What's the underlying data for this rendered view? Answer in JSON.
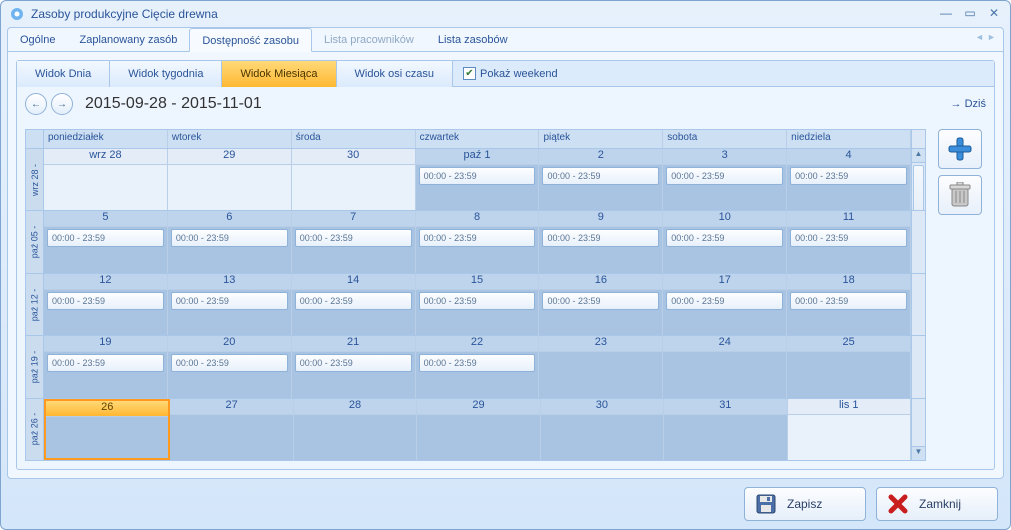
{
  "window": {
    "title": "Zasoby produkcyjne Cięcie drewna"
  },
  "mainTabs": {
    "items": [
      {
        "label": "Ogólne",
        "active": false,
        "disabled": false
      },
      {
        "label": "Zaplanowany zasób",
        "active": false,
        "disabled": false
      },
      {
        "label": "Dostępność zasobu",
        "active": true,
        "disabled": false
      },
      {
        "label": "Lista pracowników",
        "active": false,
        "disabled": true
      },
      {
        "label": "Lista zasobów",
        "active": false,
        "disabled": false
      }
    ]
  },
  "viewTabs": {
    "items": [
      {
        "label": "Widok Dnia",
        "active": false
      },
      {
        "label": "Widok tygodnia",
        "active": false
      },
      {
        "label": "Widok Miesiąca",
        "active": true
      },
      {
        "label": "Widok osi czasu",
        "active": false
      }
    ],
    "showWeekendLabel": "Pokaż weekend",
    "showWeekendChecked": true
  },
  "dateRange": "2015-09-28 - 2015-11-01",
  "todayLabel": "Dziś",
  "dayHeaders": [
    "poniedziałek",
    "wtorek",
    "środa",
    "czwartek",
    "piątek",
    "sobota",
    "niedziela"
  ],
  "entryText": "00:00 - 23:59",
  "rows": [
    {
      "label": "wrz 28 -",
      "cells": [
        {
          "day": "wrz 28",
          "outside": true,
          "entry": false
        },
        {
          "day": "29",
          "outside": true,
          "entry": false
        },
        {
          "day": "30",
          "outside": true,
          "entry": false
        },
        {
          "day": "paź 1",
          "outside": false,
          "entry": true
        },
        {
          "day": "2",
          "outside": false,
          "entry": true
        },
        {
          "day": "3",
          "outside": false,
          "entry": true
        },
        {
          "day": "4",
          "outside": false,
          "entry": true
        }
      ]
    },
    {
      "label": "paź 05 -",
      "cells": [
        {
          "day": "5",
          "outside": false,
          "entry": true
        },
        {
          "day": "6",
          "outside": false,
          "entry": true
        },
        {
          "day": "7",
          "outside": false,
          "entry": true
        },
        {
          "day": "8",
          "outside": false,
          "entry": true
        },
        {
          "day": "9",
          "outside": false,
          "entry": true
        },
        {
          "day": "10",
          "outside": false,
          "entry": true
        },
        {
          "day": "11",
          "outside": false,
          "entry": true
        }
      ]
    },
    {
      "label": "paź 12 -",
      "cells": [
        {
          "day": "12",
          "outside": false,
          "entry": true
        },
        {
          "day": "13",
          "outside": false,
          "entry": true
        },
        {
          "day": "14",
          "outside": false,
          "entry": true
        },
        {
          "day": "15",
          "outside": false,
          "entry": true
        },
        {
          "day": "16",
          "outside": false,
          "entry": true
        },
        {
          "day": "17",
          "outside": false,
          "entry": true
        },
        {
          "day": "18",
          "outside": false,
          "entry": true
        }
      ]
    },
    {
      "label": "paź 19 -",
      "cells": [
        {
          "day": "19",
          "outside": false,
          "entry": true
        },
        {
          "day": "20",
          "outside": false,
          "entry": true
        },
        {
          "day": "21",
          "outside": false,
          "entry": true
        },
        {
          "day": "22",
          "outside": false,
          "entry": true
        },
        {
          "day": "23",
          "outside": false,
          "entry": false
        },
        {
          "day": "24",
          "outside": false,
          "entry": false
        },
        {
          "day": "25",
          "outside": false,
          "entry": false
        }
      ]
    },
    {
      "label": "paź 26 -",
      "cells": [
        {
          "day": "26",
          "outside": false,
          "entry": false,
          "selected": true
        },
        {
          "day": "27",
          "outside": false,
          "entry": false
        },
        {
          "day": "28",
          "outside": false,
          "entry": false
        },
        {
          "day": "29",
          "outside": false,
          "entry": false
        },
        {
          "day": "30",
          "outside": false,
          "entry": false
        },
        {
          "day": "31",
          "outside": false,
          "entry": false
        },
        {
          "day": "lis 1",
          "outside": true,
          "entry": false
        }
      ]
    }
  ],
  "footer": {
    "save": "Zapisz",
    "close": "Zamknij"
  }
}
